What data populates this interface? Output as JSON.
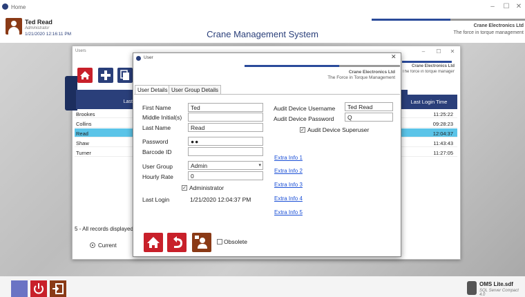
{
  "window": {
    "title": "Home",
    "controls": [
      "–",
      "☐",
      "✕"
    ]
  },
  "header": {
    "user_name": "Ted Read",
    "user_role": "Administrator",
    "user_time": "1/21/2020 12:16:11 PM",
    "app_title": "Crane Management System",
    "brand_name": "Crane Electronics Ltd",
    "brand_tag": "The force in torque management"
  },
  "users_window": {
    "title": "Users",
    "brand_name": "Crane Electronics Ltd",
    "brand_tag": "The force in torque management",
    "col_last_name": "Last",
    "col_last_login": "Last Login Time",
    "rows": [
      {
        "last_name": "Brookes",
        "last_login": "11:25:22",
        "selected": false
      },
      {
        "last_name": "Collins",
        "last_login": "09:28:23",
        "selected": false
      },
      {
        "last_name": "Read",
        "last_login": "12:04:37",
        "selected": true
      },
      {
        "last_name": "Shaw",
        "last_login": "11:43:43",
        "selected": false
      },
      {
        "last_name": "Turner",
        "last_login": "11:27:05",
        "selected": false
      }
    ],
    "status": "5 - All records displayed",
    "radio_current": "Current"
  },
  "user_dialog": {
    "title": "User",
    "close": "✕",
    "brand_name": "Crane Electronics Ltd",
    "brand_tag": "The Force in Torque Management",
    "tabs": [
      "User Details",
      "User Group Details"
    ],
    "labels": {
      "first_name": "First Name",
      "middle_initials": "Middle Initial(s)",
      "last_name": "Last Name",
      "password": "Password",
      "barcode_id": "Barcode ID",
      "user_group": "User Group",
      "hourly_rate": "Hourly Rate",
      "administrator": "Administrator",
      "last_login": "Last Login",
      "audit_username": "Audit Device Username",
      "audit_password": "Audit Device Password",
      "audit_superuser": "Audit Device Superuser",
      "obsolete": "Obsolete"
    },
    "values": {
      "first_name": "Ted",
      "middle_initials": "",
      "last_name": "Read",
      "password": "●●",
      "barcode_id": "",
      "user_group": "Admin",
      "hourly_rate": "0",
      "administrator_checked": "✓",
      "last_login": "1/21/2020 12:04:37 PM",
      "audit_username": "Ted Read",
      "audit_password": "Q",
      "audit_superuser_checked": "✓"
    },
    "links": [
      "Extra Info 1",
      "Extra Info 2",
      "Extra Info 3",
      "Extra Info 4",
      "Extra Info 5"
    ]
  },
  "footer": {
    "db_name": "OMS Lite.sdf",
    "db_type": "SQL Server Compact 4.0"
  },
  "colors": {
    "navy": "#2a3f7a",
    "red": "#c8202a",
    "brown": "#8a3a16",
    "selected_row": "#5bc4e8",
    "link": "#1a4fd6"
  }
}
